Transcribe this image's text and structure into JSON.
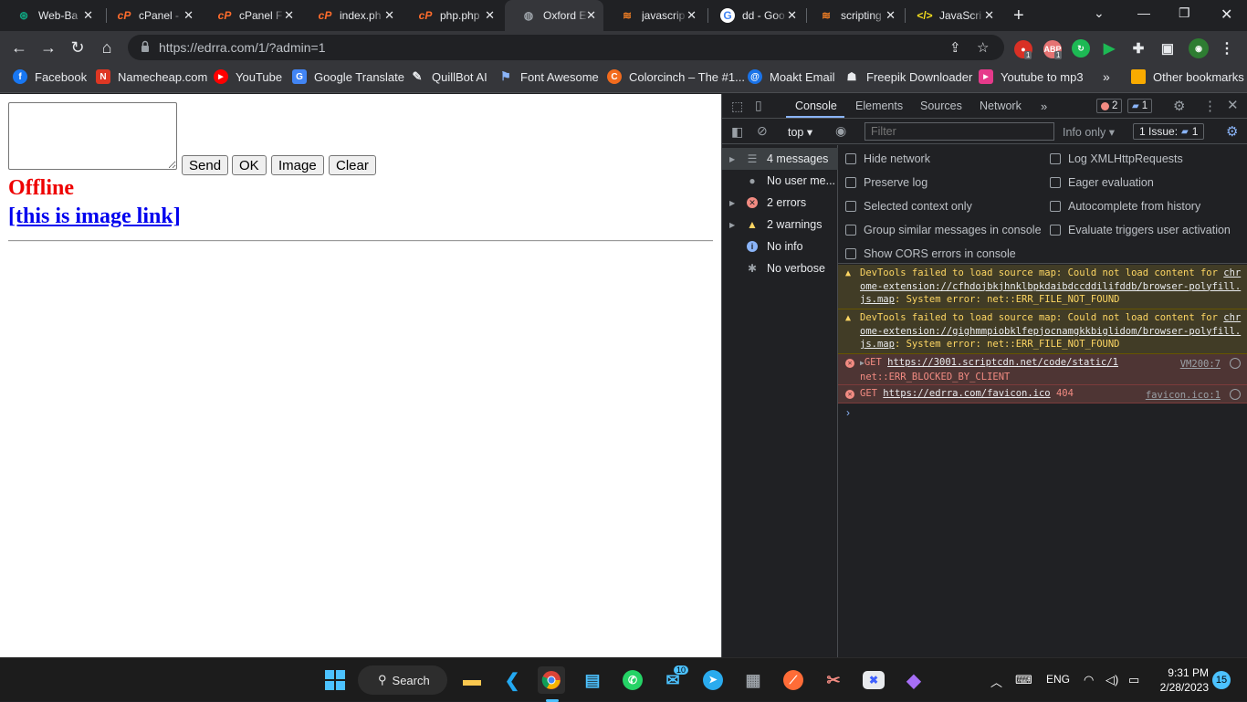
{
  "tabs": [
    {
      "title": "Web-Ba",
      "icon": "chatgpt-icon"
    },
    {
      "title": "cPanel -",
      "icon": "cpanel-icon"
    },
    {
      "title": "cPanel F",
      "icon": "cpanel-icon"
    },
    {
      "title": "index.ph",
      "icon": "cpanel-icon"
    },
    {
      "title": "php.php",
      "icon": "cpanel-icon"
    },
    {
      "title": "Oxford E",
      "icon": "globe-icon"
    },
    {
      "title": "javascrip",
      "icon": "stackoverflow-icon"
    },
    {
      "title": "dd - Goo",
      "icon": "google-icon"
    },
    {
      "title": "scripting",
      "icon": "stackoverflow-icon"
    },
    {
      "title": "JavaScri",
      "icon": "code-icon"
    }
  ],
  "address_bar": {
    "url": "https://edrra.com/1/?admin=1"
  },
  "extensions": {
    "badge1": "1",
    "badge2": "1"
  },
  "bookmarks": [
    {
      "label": "Facebook",
      "icon": "facebook-icon",
      "color": "#1877f2"
    },
    {
      "label": "Namecheap.com",
      "icon": "namecheap-icon",
      "color": "#de3723"
    },
    {
      "label": "YouTube",
      "icon": "youtube-icon",
      "color": "#ff0000"
    },
    {
      "label": "Google Translate",
      "icon": "translate-icon",
      "color": "#4285f4"
    },
    {
      "label": "QuillBot AI",
      "icon": "quill-icon",
      "color": "#35363a"
    },
    {
      "label": "Font Awesome",
      "icon": "flag-icon",
      "color": "#35363a"
    },
    {
      "label": "Colorcinch – The #1...",
      "icon": "colorcinch-icon",
      "color": "#f26b1d"
    },
    {
      "label": "Moakt Email",
      "icon": "at-icon",
      "color": "#1a73e8"
    },
    {
      "label": "Freepik Downloader",
      "icon": "freepik-icon",
      "color": "#35363a"
    },
    {
      "label": "Youtube to mp3",
      "icon": "play-icon",
      "color": "#e63a8b"
    }
  ],
  "other_bookmarks": "Other bookmarks",
  "page": {
    "buttons": {
      "send": "Send",
      "ok": "OK",
      "image": "Image",
      "clear": "Clear"
    },
    "status": "Offline",
    "image_link": "[this is image link]"
  },
  "devtools": {
    "tabs": {
      "console": "Console",
      "elements": "Elements",
      "sources": "Sources",
      "network": "Network"
    },
    "error_count": "2",
    "info_count": "1",
    "context": "top",
    "filter_placeholder": "Filter",
    "level": "Info only",
    "issues": "1 Issue:",
    "issues_count": "1",
    "sidebar": [
      {
        "label": "4 messages",
        "icon": "list-icon",
        "expandable": true
      },
      {
        "label": "No user me...",
        "icon": "user-icon",
        "expandable": false
      },
      {
        "label": "2 errors",
        "icon": "error-icon",
        "expandable": true
      },
      {
        "label": "2 warnings",
        "icon": "warning-icon",
        "expandable": true
      },
      {
        "label": "No info",
        "icon": "info-icon",
        "expandable": false
      },
      {
        "label": "No verbose",
        "icon": "bug-icon",
        "expandable": false
      }
    ],
    "settings_left": [
      "Hide network",
      "Preserve log",
      "Selected context only",
      "Group similar messages in console",
      "Show CORS errors in console"
    ],
    "settings_right": [
      "Log XMLHttpRequests",
      "Eager evaluation",
      "Autocomplete from history",
      "Evaluate triggers user activation"
    ],
    "logs": {
      "w1_pre": "DevTools failed to load source map: Could not load content for ",
      "w1_link": "chrome-extension://cfhdojbkjhnklbpkdaibdccddilifddb/browser-polyfill.js.map",
      "w1_post": ": System error: net::ERR_FILE_NOT_FOUND",
      "w2_pre": "DevTools failed to load source map: Could not load content for ",
      "w2_link": "chrome-extension://gighmmpiobklfepjocnamgkkbiglidom/browser-polyfill.js.map",
      "w2_post": ": System error: net::ERR_FILE_NOT_FOUND",
      "e1_method": "GET",
      "e1_link": "https://3001.scriptcdn.net/code/static/1",
      "e1_detail": "net::ERR_BLOCKED_BY_CLIENT",
      "e1_src": "VM200:7",
      "e2_method": "GET",
      "e2_link": "https://edrra.com/favicon.ico",
      "e2_status": "404",
      "e2_src": "favicon.ico:1"
    }
  },
  "taskbar": {
    "search": "Search",
    "mail_badge": "10",
    "lang": "ENG",
    "time": "9:31 PM",
    "date": "2/28/2023",
    "notifications": "15"
  }
}
